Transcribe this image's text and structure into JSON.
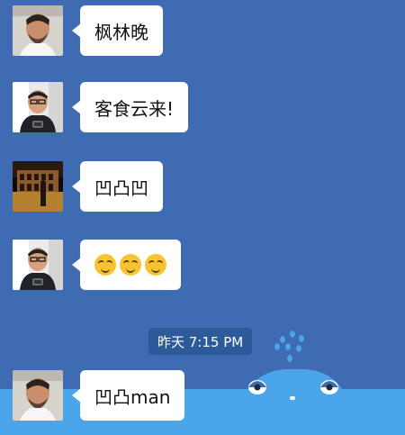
{
  "messages": [
    {
      "text": "枫林晚",
      "avatar": "avatar"
    },
    {
      "text": "客食云来!",
      "avatar": "avatar"
    },
    {
      "text": "凹凸凹",
      "avatar": "avatar"
    },
    {
      "text": "",
      "avatar": "avatar",
      "emoji_count": 3
    },
    {
      "text": "凹凸man",
      "avatar": "avatar"
    }
  ],
  "timestamp": "昨天 7:15 PM",
  "colors": {
    "background": "#3f6bb3",
    "water": "#4aa6e8",
    "bubble": "#ffffff",
    "timestamp_bg": "#2d5a98",
    "emoji": "#f7c431"
  },
  "icons": {
    "whale": "whale-icon",
    "emoji": "squint-smile-emoji-icon"
  }
}
